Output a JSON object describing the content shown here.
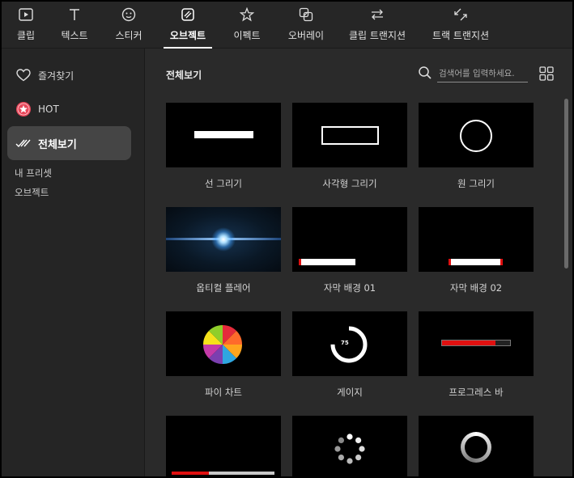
{
  "tabs": [
    {
      "label": "클립",
      "icon": "clip-icon"
    },
    {
      "label": "텍스트",
      "icon": "text-icon"
    },
    {
      "label": "스티커",
      "icon": "sticker-icon"
    },
    {
      "label": "오브젝트",
      "icon": "object-icon",
      "active": true
    },
    {
      "label": "이펙트",
      "icon": "effect-icon"
    },
    {
      "label": "오버레이",
      "icon": "overlay-icon"
    },
    {
      "label": "클립 트랜지션",
      "icon": "clip-transition-icon"
    },
    {
      "label": "트랙 트랜지션",
      "icon": "track-transition-icon"
    }
  ],
  "sidebar": {
    "items": [
      {
        "label": "즐겨찾기",
        "icon": "heart-icon"
      },
      {
        "label": "HOT",
        "icon": "hot-badge-icon"
      },
      {
        "label": "전체보기",
        "icon": "check-all-icon",
        "active": true
      }
    ],
    "section_label": "내 프리셋",
    "section_item": "오브젝트"
  },
  "main": {
    "title": "전체보기",
    "search_placeholder": "검색어를 입력하세요."
  },
  "tiles": [
    {
      "label": "선 그리기",
      "thumb": "line"
    },
    {
      "label": "사각형 그리기",
      "thumb": "rect"
    },
    {
      "label": "원 그리기",
      "thumb": "circle"
    },
    {
      "label": "옵티컬 플레어",
      "thumb": "flare"
    },
    {
      "label": "자막 배경 01",
      "thumb": "subtitle01"
    },
    {
      "label": "자막 배경 02",
      "thumb": "subtitle02"
    },
    {
      "label": "파이 차트",
      "thumb": "pie"
    },
    {
      "label": "게이지",
      "thumb": "gauge",
      "gauge_value": "75"
    },
    {
      "label": "프로그레스 바",
      "thumb": "progress"
    },
    {
      "label": "",
      "thumb": "bar-bottom"
    },
    {
      "label": "",
      "thumb": "spinner"
    },
    {
      "label": "",
      "thumb": "ring"
    }
  ],
  "colors": {
    "accent_red": "#e01010",
    "hot_badge": "#e8475a",
    "flare_blue": "#3fa0ff"
  }
}
